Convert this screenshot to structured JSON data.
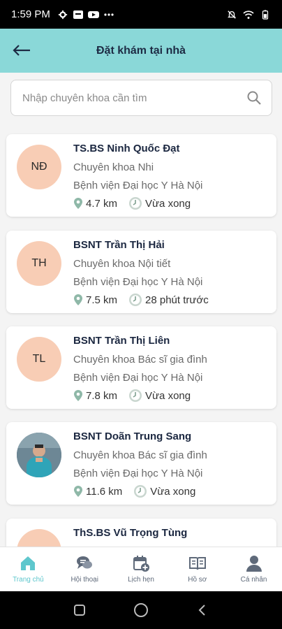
{
  "status_bar": {
    "time": "1:59 PM"
  },
  "header": {
    "title": "Đặt khám tại nhà"
  },
  "search": {
    "placeholder": "Nhập chuyên khoa cần tìm",
    "value": ""
  },
  "doctors": [
    {
      "initials": "NĐ",
      "name": "TS.BS Ninh Quốc Đạt",
      "specialty": "Chuyên khoa Nhi",
      "hospital": "Bệnh viện Đại học Y Hà Nội",
      "distance": "4.7 km",
      "time": "Vừa xong"
    },
    {
      "initials": "TH",
      "name": "BSNT Trần Thị Hải",
      "specialty": "Chuyên khoa Nội tiết",
      "hospital": "Bệnh viện Đại học Y Hà Nội",
      "distance": "7.5 km",
      "time": "28 phút trước"
    },
    {
      "initials": "TL",
      "name": "BSNT Trần Thị Liên",
      "specialty": "Chuyên khoa Bác sĩ gia đình",
      "hospital": "Bệnh viện Đại học Y Hà Nội",
      "distance": "7.8 km",
      "time": "Vừa xong"
    },
    {
      "initials": "",
      "name": "BSNT Doãn Trung Sang",
      "specialty": "Chuyên khoa Bác sĩ gia đình",
      "hospital": "Bệnh viện Đại học Y Hà Nội",
      "distance": "11.6 km",
      "time": "Vừa xong"
    },
    {
      "initials": "",
      "name": "ThS.BS Vũ Trọng Tùng",
      "specialty": "",
      "hospital": "",
      "distance": "",
      "time": ""
    }
  ],
  "bottom_nav": [
    {
      "label": "Trang chủ",
      "icon": "home-icon",
      "active": true
    },
    {
      "label": "Hội thoại",
      "icon": "chat-icon",
      "active": false
    },
    {
      "label": "Lịch hẹn",
      "icon": "calendar-add-icon",
      "active": false
    },
    {
      "label": "Hồ sơ",
      "icon": "records-book-icon",
      "active": false
    },
    {
      "label": "Cá nhân",
      "icon": "person-icon",
      "active": false
    }
  ],
  "colors": {
    "header_bg": "#8ad8d8",
    "accent": "#5fc7cd",
    "avatar_bg": "#f8cdb5",
    "nav_icon": "#5f6a7a"
  }
}
